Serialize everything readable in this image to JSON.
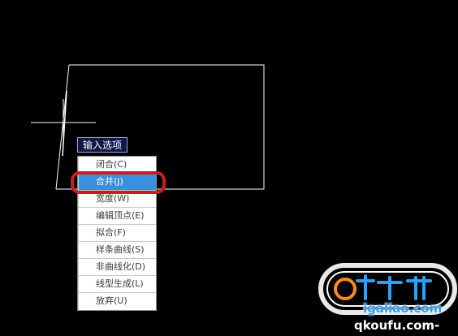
{
  "prompt": {
    "label": "输入选项"
  },
  "menu": {
    "items": [
      {
        "label": "闭合(C)",
        "active": false
      },
      {
        "label": "合并(J)",
        "active": true
      },
      {
        "label": "宽度(W)",
        "active": false
      },
      {
        "label": "编辑顶点(E)",
        "active": false
      },
      {
        "label": "拟合(F)",
        "active": false
      },
      {
        "label": "样条曲线(S)",
        "active": false
      },
      {
        "label": "非曲线化(D)",
        "active": false
      },
      {
        "label": "线型生成(L)",
        "active": false
      },
      {
        "label": "放弃(U)",
        "active": false
      }
    ]
  },
  "watermark": {
    "url": "igaliao.com",
    "url_fragment": "qkoufu.com-"
  },
  "colors": {
    "canvas": "#000000",
    "line": "#ffffff",
    "highlight": "#c81e1e",
    "menu_active": "#3b8fe0",
    "prompt_bg": "#10184a"
  }
}
